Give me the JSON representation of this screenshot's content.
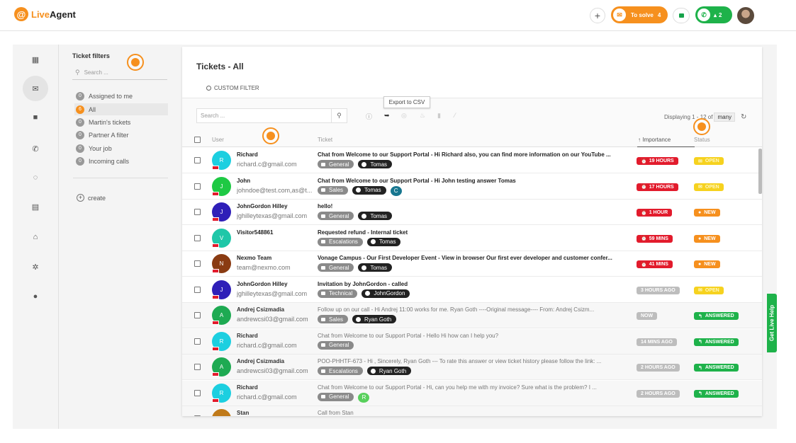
{
  "app": {
    "brand_a": "Live",
    "brand_b": "Agent"
  },
  "topbar": {
    "solve_label": "To solve",
    "solve_count": "4",
    "calls_count": "2"
  },
  "filters": {
    "title": "Ticket filters",
    "search_placeholder": "Search ...",
    "items": [
      {
        "label": "Assigned to me",
        "count": "0"
      },
      {
        "label": "All",
        "count": "6"
      },
      {
        "label": "Martin's tickets",
        "count": "0"
      },
      {
        "label": "Partner A filter",
        "count": "0"
      },
      {
        "label": "Your job",
        "count": "0"
      },
      {
        "label": "Incoming calls",
        "count": "0"
      }
    ],
    "create_label": "create"
  },
  "main": {
    "title": "Tickets - All",
    "custom_filter": "CUSTOM FILTER",
    "search_placeholder": "Search ...",
    "tooltip": "Export to CSV",
    "displaying_text": "Displaying 1 - 12 of",
    "displaying_total": "many",
    "columns": {
      "user": "User",
      "ticket": "Ticket",
      "importance": "↑ Importance",
      "status": "Status"
    }
  },
  "rows": [
    {
      "name": "Richard",
      "email": "richard.c@gmail.com",
      "initial": "R",
      "avatar_color": "#1ccfe0",
      "subject": "Chat from Welcome to our Support Portal - Hi Richard also, you can find more information on our YouTube ...",
      "dept": "General",
      "agent": "Tomas",
      "importance": "19 HOURS",
      "status": "OPEN"
    },
    {
      "name": "John",
      "email": "johndoe@test.com,as@t...",
      "initial": "J",
      "avatar_color": "#1ec944",
      "subject": "Chat from Welcome to our Support Portal - Hi John testing answer Tomas",
      "dept": "Sales",
      "agent": "Tomas",
      "extra": "C",
      "importance": "17 HOURS",
      "status": "OPEN"
    },
    {
      "name": "JohnGordon Hilley",
      "email": "jghilleytexas@gmail.com",
      "initial": "J",
      "avatar_color": "#2f1fb8",
      "subject": "hello!",
      "dept": "General",
      "agent": "Tomas",
      "importance": "1 HOUR",
      "status": "NEW"
    },
    {
      "name": "Visitor548861",
      "email": "",
      "initial": "V",
      "avatar_color": "#1fc7a8",
      "subject": "Requested refund - Internal ticket",
      "dept": "Escalations",
      "agent": "Tomas",
      "importance": "59 MINS",
      "status": "NEW"
    },
    {
      "name": "Nexmo Team",
      "email": "team@nexmo.com",
      "initial": "N",
      "avatar_color": "#8a3b12",
      "subject": "Vonage Campus - Our First Developer Event - View in browser Our first ever developer and customer confer...",
      "dept": "General",
      "agent": "Tomas",
      "importance": "41 MINS",
      "status": "NEW"
    },
    {
      "name": "JohnGordon Hilley",
      "email": "jghilleytexas@gmail.com",
      "initial": "J",
      "avatar_color": "#2f1fb8",
      "subject": "Invitation by JohnGordon - called",
      "dept": "Technical",
      "agent": "JohnGordon",
      "importance": "3 HOURS AGO",
      "status": "OPEN"
    },
    {
      "name": "Andrej Csizmadia",
      "email": "andrewcsi03@gmail.com",
      "initial": "A",
      "avatar_color": "#1eaa52",
      "subject": "Follow up on our call - Hi Andrej 11:00 works for me. Ryan Goth ----Original message---- From: Andrej Csizm...",
      "dept": "Sales",
      "agent": "Ryan Goth",
      "importance": "NOW",
      "status": "ANSWERED"
    },
    {
      "name": "Richard",
      "email": "richard.c@gmail.com",
      "initial": "R",
      "avatar_color": "#1ccfe0",
      "subject": "Chat from Welcome to our Support Portal - Hello Hi how can I help you?",
      "dept": "General",
      "agent": "",
      "importance": "14 MINS AGO",
      "status": "ANSWERED"
    },
    {
      "name": "Andrej Csizmadia",
      "email": "andrewcsi03@gmail.com",
      "initial": "A",
      "avatar_color": "#1eaa52",
      "subject": "POO-PHHTF-673 - Hi , Sincerely, Ryan Goth --- To rate this answer or view ticket history please follow the link: ...",
      "dept": "Escalations",
      "agent": "Ryan Goth",
      "importance": "2 HOURS AGO",
      "status": "ANSWERED"
    },
    {
      "name": "Richard",
      "email": "richard.c@gmail.com",
      "initial": "R",
      "avatar_color": "#1ccfe0",
      "subject": "Chat from Welcome to our Support Portal - Hi, can you help me with my invoice? Sure what is the problem? I ...",
      "dept": "General",
      "agent": "",
      "extra": "R",
      "importance": "2 HOURS AGO",
      "status": "ANSWERED"
    },
    {
      "name": "Stan",
      "email": "",
      "initial": "S",
      "avatar_color": "#c07a1a",
      "subject": "Call from Stan",
      "dept": "",
      "agent": "",
      "importance": "",
      "status": ""
    }
  ],
  "livehelp": "Get Live Help",
  "colors": {
    "brand": "#f6901e",
    "red": "#e21b2c",
    "green": "#1eb24a",
    "yellow": "#f6d21f"
  },
  "icons": [
    "dashboard-icon",
    "mail-icon",
    "chat-icon",
    "phone-icon",
    "reports-icon",
    "contacts-icon",
    "bank-icon",
    "settings-icon",
    "plugins-icon",
    "search-icon",
    "refresh-icon",
    "info-icon",
    "export-icon",
    "check-icon",
    "fire-icon",
    "trash-icon",
    "wand-icon"
  ]
}
